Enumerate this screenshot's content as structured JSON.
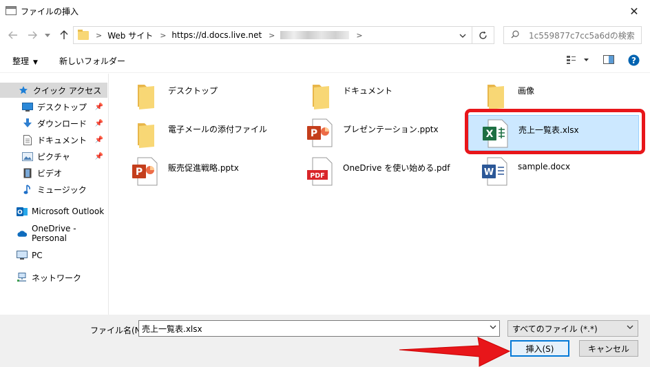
{
  "window": {
    "title": "ファイルの挿入",
    "close_glyph": "✕"
  },
  "address": {
    "crumbs": [
      "Web サイト",
      "https://d.docs.live.net"
    ],
    "search_placeholder": "1c559877c7cc5a6dの検索"
  },
  "toolbar": {
    "organize": "整理",
    "new_folder": "新しいフォルダー"
  },
  "sidebar": {
    "items": [
      {
        "label": "クイック アクセス",
        "icon": "star-icon",
        "pinned": false,
        "selected": true
      },
      {
        "label": "デスクトップ",
        "icon": "desktop-icon",
        "pinned": true
      },
      {
        "label": "ダウンロード",
        "icon": "download-icon",
        "pinned": true
      },
      {
        "label": "ドキュメント",
        "icon": "document-icon",
        "pinned": true
      },
      {
        "label": "ピクチャ",
        "icon": "pictures-icon",
        "pinned": true
      },
      {
        "label": "ビデオ",
        "icon": "video-icon",
        "pinned": false
      },
      {
        "label": "ミュージック",
        "icon": "music-icon",
        "pinned": false
      },
      {
        "label": "Microsoft Outlook",
        "icon": "outlook-icon",
        "pinned": false
      },
      {
        "label": "OneDrive - Personal",
        "icon": "onedrive-icon",
        "pinned": false
      },
      {
        "label": "PC",
        "icon": "pc-icon",
        "pinned": false
      },
      {
        "label": "ネットワーク",
        "icon": "network-icon",
        "pinned": false
      }
    ]
  },
  "files": [
    {
      "name": "デスクトップ",
      "type": "folder"
    },
    {
      "name": "ドキュメント",
      "type": "folder"
    },
    {
      "name": "画像",
      "type": "folder"
    },
    {
      "name": "電子メールの添付ファイル",
      "type": "folder"
    },
    {
      "name": "プレゼンテーション.pptx",
      "type": "pptx"
    },
    {
      "name": "売上一覧表.xlsx",
      "type": "xlsx",
      "selected": true
    },
    {
      "name": "販売促進戦略.pptx",
      "type": "pptx"
    },
    {
      "name": "OneDrive を使い始める.pdf",
      "type": "pdf"
    },
    {
      "name": "sample.docx",
      "type": "docx"
    }
  ],
  "icon_text": {
    "ppt": "P",
    "xls": "X",
    "pdf": "PDF",
    "word": "W"
  },
  "footer": {
    "filename_label": "ファイル名(N):",
    "filename_value": "売上一覧表.xlsx",
    "filetype_value": "すべてのファイル (*.*)",
    "insert_label": "挿入(S)",
    "cancel_label": "キャンセル"
  },
  "colors": {
    "accent": "#0078d7",
    "selection": "#cce8ff",
    "highlight_red": "#e8161a",
    "excel_green": "#1d6f42",
    "ppt_orange": "#c43e1c",
    "pdf_red": "#d9262a",
    "word_blue": "#2b5797",
    "folder_yellow": "#f8d775"
  }
}
